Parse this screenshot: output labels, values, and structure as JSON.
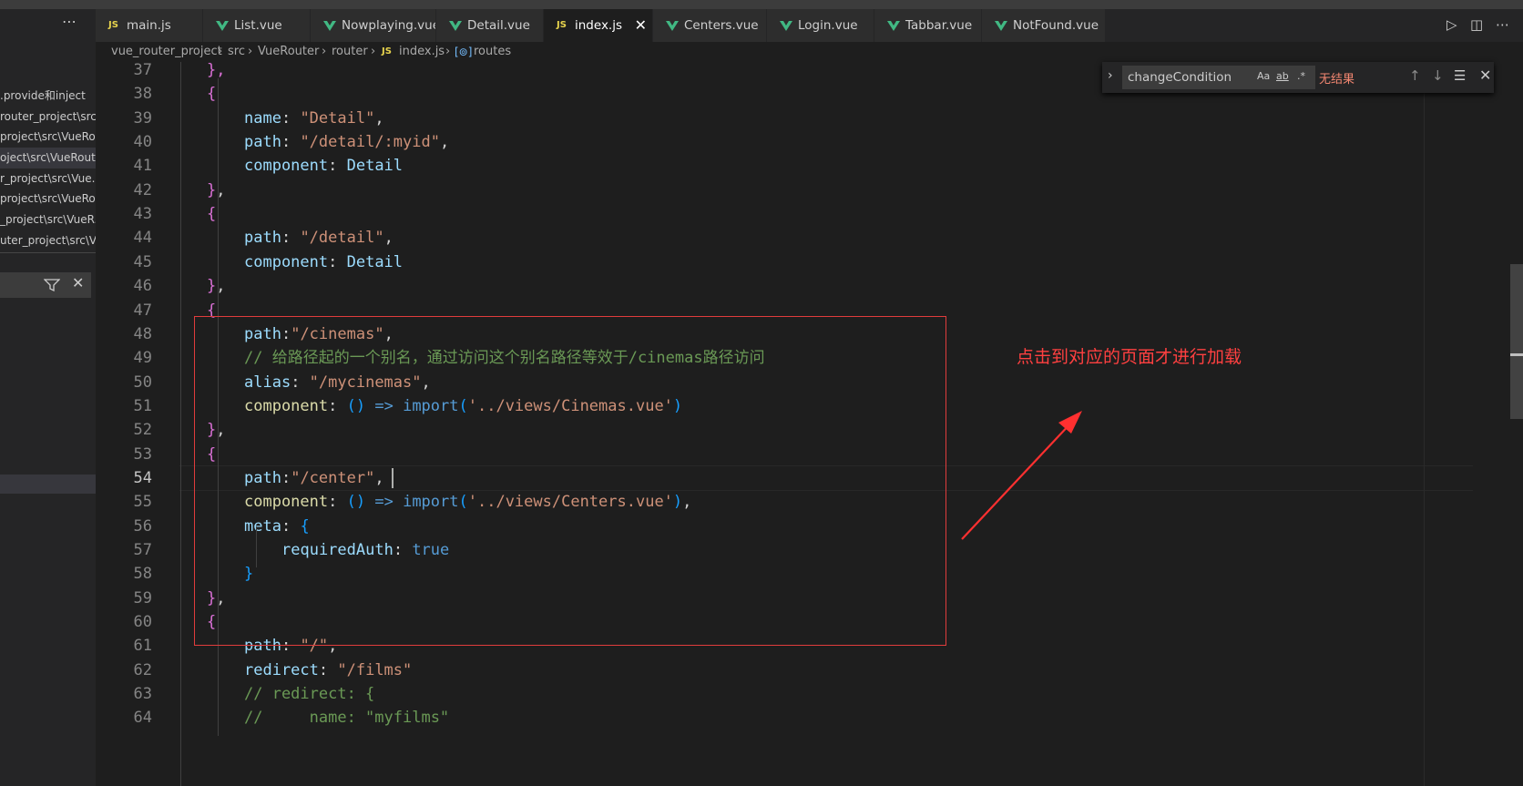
{
  "sidebar": {
    "items": [
      ".provide和inject",
      "router_project\\src...",
      "project\\src\\VueRo...",
      "oject\\src\\VueRout...",
      "r_project\\src\\Vue...",
      "project\\src\\VueRo...",
      "_project\\src\\VueR...",
      "uter_project\\src\\V..."
    ]
  },
  "tabs": [
    {
      "label": "main.js",
      "type": "js"
    },
    {
      "label": "List.vue",
      "type": "vue"
    },
    {
      "label": "Nowplaying.vue",
      "type": "vue"
    },
    {
      "label": "Detail.vue",
      "type": "vue"
    },
    {
      "label": "index.js",
      "type": "js",
      "active": true
    },
    {
      "label": "Centers.vue",
      "type": "vue"
    },
    {
      "label": "Login.vue",
      "type": "vue"
    },
    {
      "label": "Tabbar.vue",
      "type": "vue"
    },
    {
      "label": "NotFound.vue",
      "type": "vue"
    }
  ],
  "breadcrumb": [
    "vue_router_project",
    "src",
    "VueRouter",
    "router",
    "index.js",
    "routes"
  ],
  "find": {
    "query": "changeCondition",
    "result": "无结果"
  },
  "annotation": {
    "text": "点击到对应的页面才进行加载"
  },
  "editor": {
    "current_line": 54,
    "lines": [
      {
        "n": 37,
        "i": 1,
        "t": [
          [
            "b1",
            "},"
          ]
        ]
      },
      {
        "n": 38,
        "i": 1,
        "t": [
          [
            "b1",
            "{"
          ]
        ]
      },
      {
        "n": 39,
        "i": 2,
        "t": [
          [
            "k",
            "name"
          ],
          [
            "p",
            ": "
          ],
          [
            "s",
            "\"Detail\""
          ],
          [
            "p",
            ","
          ]
        ]
      },
      {
        "n": 40,
        "i": 2,
        "t": [
          [
            "k",
            "path"
          ],
          [
            "p",
            ": "
          ],
          [
            "s",
            "\"/detail/:myid\""
          ],
          [
            "p",
            ","
          ]
        ]
      },
      {
        "n": 41,
        "i": 2,
        "t": [
          [
            "k",
            "component"
          ],
          [
            "p",
            ": "
          ],
          [
            "k",
            "Detail"
          ]
        ]
      },
      {
        "n": 42,
        "i": 1,
        "t": [
          [
            "b1",
            "}"
          ],
          [
            "p",
            ","
          ]
        ]
      },
      {
        "n": 43,
        "i": 1,
        "t": [
          [
            "b1",
            "{"
          ]
        ]
      },
      {
        "n": 44,
        "i": 2,
        "t": [
          [
            "k",
            "path"
          ],
          [
            "p",
            ": "
          ],
          [
            "s",
            "\"/detail\""
          ],
          [
            "p",
            ","
          ]
        ]
      },
      {
        "n": 45,
        "i": 2,
        "t": [
          [
            "k",
            "component"
          ],
          [
            "p",
            ": "
          ],
          [
            "k",
            "Detail"
          ]
        ]
      },
      {
        "n": 46,
        "i": 1,
        "t": [
          [
            "b1",
            "}"
          ],
          [
            "p",
            ","
          ]
        ]
      },
      {
        "n": 47,
        "i": 1,
        "t": [
          [
            "b1",
            "{"
          ]
        ]
      },
      {
        "n": 48,
        "i": 2,
        "t": [
          [
            "k",
            "path"
          ],
          [
            "p",
            ":"
          ],
          [
            "s",
            "\"/cinemas\""
          ],
          [
            "p",
            ","
          ]
        ]
      },
      {
        "n": 49,
        "i": 2,
        "t": [
          [
            "c",
            "// 给路径起的一个别名，通过访问这个别名路径等效于/cinemas路径访问"
          ]
        ]
      },
      {
        "n": 50,
        "i": 2,
        "t": [
          [
            "k",
            "alias"
          ],
          [
            "p",
            ": "
          ],
          [
            "s",
            "\"/mycinemas\""
          ],
          [
            "p",
            ","
          ]
        ]
      },
      {
        "n": 51,
        "i": 2,
        "t": [
          [
            "f",
            "component"
          ],
          [
            "p",
            ": "
          ],
          [
            "b2",
            "()"
          ],
          [
            "p",
            " "
          ],
          [
            "kw",
            "=>"
          ],
          [
            "p",
            " "
          ],
          [
            "kw",
            "import"
          ],
          [
            "b2",
            "("
          ],
          [
            "s",
            "'../views/Cinemas.vue'"
          ],
          [
            "b2",
            ")"
          ]
        ]
      },
      {
        "n": 52,
        "i": 1,
        "t": [
          [
            "b1",
            "}"
          ],
          [
            "p",
            ","
          ]
        ]
      },
      {
        "n": 53,
        "i": 1,
        "t": [
          [
            "b1",
            "{"
          ]
        ]
      },
      {
        "n": 54,
        "i": 2,
        "t": [
          [
            "k",
            "path"
          ],
          [
            "p",
            ":"
          ],
          [
            "s",
            "\"/center\""
          ],
          [
            "p",
            ","
          ]
        ]
      },
      {
        "n": 55,
        "i": 2,
        "t": [
          [
            "f",
            "component"
          ],
          [
            "p",
            ": "
          ],
          [
            "b2",
            "()"
          ],
          [
            "p",
            " "
          ],
          [
            "kw",
            "=>"
          ],
          [
            "p",
            " "
          ],
          [
            "kw",
            "import"
          ],
          [
            "b2",
            "("
          ],
          [
            "s",
            "'../views/Centers.vue'"
          ],
          [
            "b2",
            ")"
          ],
          [
            "p",
            ","
          ]
        ]
      },
      {
        "n": 56,
        "i": 2,
        "t": [
          [
            "k",
            "meta"
          ],
          [
            "p",
            ": "
          ],
          [
            "b2",
            "{"
          ]
        ]
      },
      {
        "n": 57,
        "i": 3,
        "t": [
          [
            "k",
            "requiredAuth"
          ],
          [
            "p",
            ": "
          ],
          [
            "kw",
            "true"
          ]
        ]
      },
      {
        "n": 58,
        "i": 2,
        "t": [
          [
            "b2",
            "}"
          ]
        ]
      },
      {
        "n": 59,
        "i": 1,
        "t": [
          [
            "b1",
            "}"
          ],
          [
            "p",
            ","
          ]
        ]
      },
      {
        "n": 60,
        "i": 1,
        "t": [
          [
            "b1",
            "{"
          ]
        ]
      },
      {
        "n": 61,
        "i": 2,
        "t": [
          [
            "k",
            "path"
          ],
          [
            "p",
            ": "
          ],
          [
            "s",
            "\"/\""
          ],
          [
            "p",
            ","
          ]
        ]
      },
      {
        "n": 62,
        "i": 2,
        "t": [
          [
            "k",
            "redirect"
          ],
          [
            "p",
            ": "
          ],
          [
            "s",
            "\"/films\""
          ]
        ]
      },
      {
        "n": 63,
        "i": 2,
        "t": [
          [
            "c",
            "// redirect: {"
          ]
        ]
      },
      {
        "n": 64,
        "i": 2,
        "t": [
          [
            "c",
            "//     name: \"myfilms\""
          ]
        ]
      }
    ]
  },
  "colors": {
    "accent": "#41b883",
    "js": "#e8d44d",
    "annotation": "#e03c3c"
  }
}
